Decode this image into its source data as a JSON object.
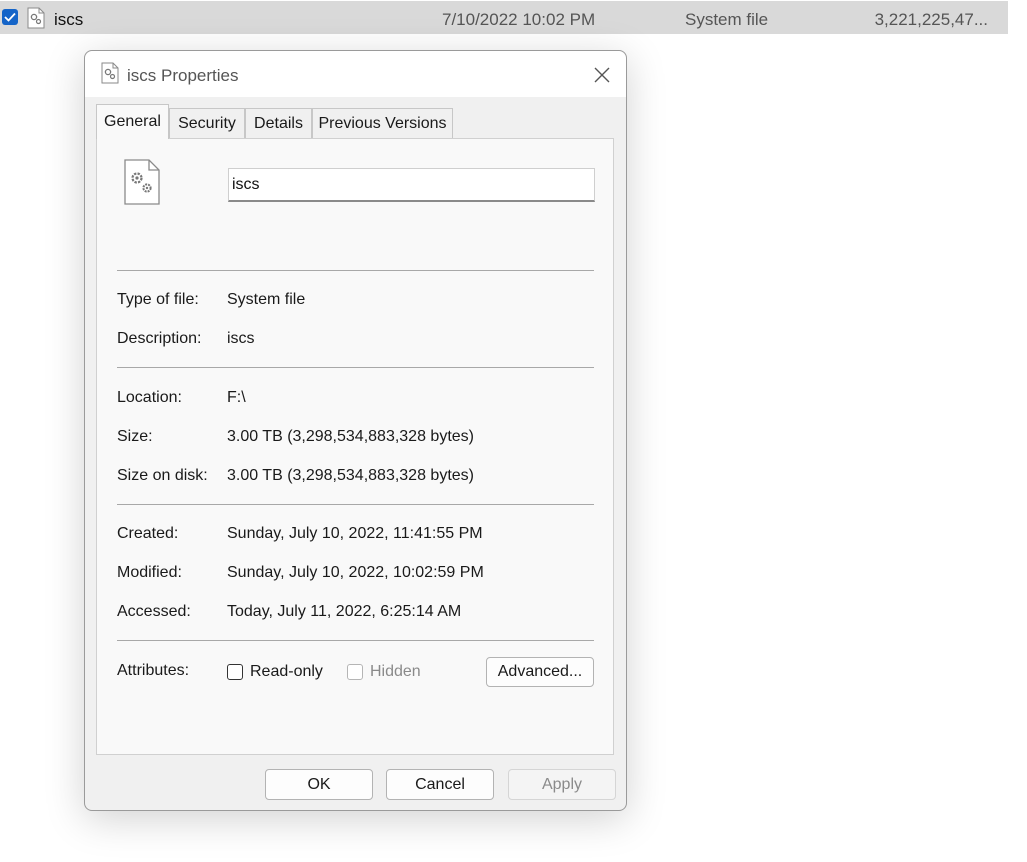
{
  "file_row": {
    "name": "iscs",
    "date_modified": "7/10/2022 10:02 PM",
    "type": "System file",
    "size": "3,221,225,47..."
  },
  "dialog": {
    "title": "iscs Properties",
    "tabs": [
      {
        "label": "General",
        "active": true
      },
      {
        "label": "Security",
        "active": false
      },
      {
        "label": "Details",
        "active": false
      },
      {
        "label": "Previous Versions",
        "active": false
      }
    ],
    "file_name": "iscs",
    "fields": {
      "type_label": "Type of file:",
      "type_value": "System file",
      "description_label": "Description:",
      "description_value": "iscs",
      "location_label": "Location:",
      "location_value": "F:\\",
      "size_label": "Size:",
      "size_value": "3.00 TB (3,298,534,883,328 bytes)",
      "size_on_disk_label": "Size on disk:",
      "size_on_disk_value": "3.00 TB (3,298,534,883,328 bytes)",
      "created_label": "Created:",
      "created_value": "Sunday, July 10, 2022, 11:41:55 PM",
      "modified_label": "Modified:",
      "modified_value": "Sunday, July 10, 2022, 10:02:59 PM",
      "accessed_label": "Accessed:",
      "accessed_value": "Today, July 11, 2022, 6:25:14 AM"
    },
    "attributes": {
      "label": "Attributes:",
      "read_only_label": "Read-only",
      "read_only_checked": false,
      "hidden_label": "Hidden",
      "hidden_checked": false,
      "advanced_label": "Advanced..."
    },
    "buttons": {
      "ok": "OK",
      "cancel": "Cancel",
      "apply": "Apply"
    }
  },
  "icons": {
    "checkbox": "checkmark-icon",
    "file": "system-file-icon",
    "close": "close-icon"
  },
  "colors": {
    "accent": "#1464c8",
    "row_selected": "#d9d9d9",
    "dialog_bg": "#f0f0f0"
  }
}
